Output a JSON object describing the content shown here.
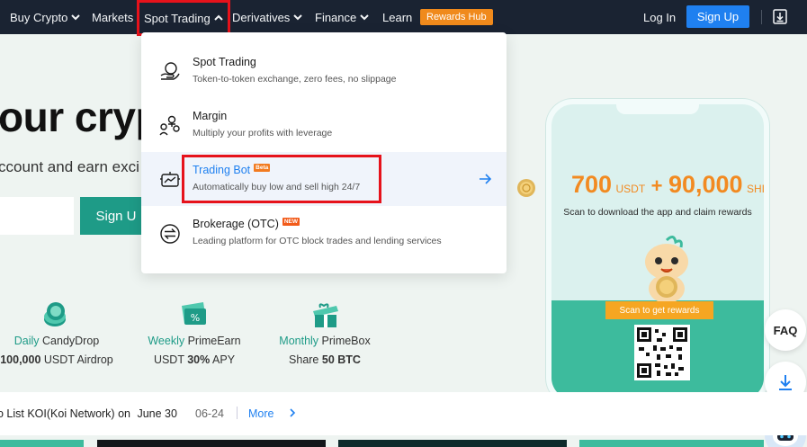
{
  "nav": {
    "items": [
      {
        "label": "Buy Crypto",
        "has_chevron": true
      },
      {
        "label": "Markets",
        "has_chevron": false
      },
      {
        "label": "Spot Trading",
        "has_chevron": true,
        "active": true
      },
      {
        "label": "Derivatives",
        "has_chevron": true
      },
      {
        "label": "Finance",
        "has_chevron": true
      },
      {
        "label": "Learn",
        "has_chevron": false
      }
    ],
    "rewards_hub": "Rewards Hub",
    "login": "Log In",
    "signup": "Sign Up",
    "download_icon": "download-icon"
  },
  "hero": {
    "title": "our cryp",
    "subtitle": "ccount and earn exci",
    "email_placeholder": "",
    "signup_label": "Sign U"
  },
  "features": [
    {
      "highlight": "Daily",
      "title": " CandyDrop",
      "desc_bold": "100,000",
      "desc": " USDT Airdrop"
    },
    {
      "highlight": "Weekly",
      "title": " PrimeEarn",
      "desc": "USDT ",
      "desc_bold": "30%",
      "desc_tail": " APY"
    },
    {
      "highlight": "Monthly",
      "title": " PrimeBox",
      "desc": "Share ",
      "desc_bold": "50 BTC"
    }
  ],
  "dropdown": {
    "items": [
      {
        "title": "Spot Trading",
        "desc": "Token-to-token exchange, zero fees, no slippage",
        "icon": "hand-coin-icon"
      },
      {
        "title": "Margin",
        "desc": "Multiply your profits with leverage",
        "icon": "people-coins-icon"
      },
      {
        "title": "Trading Bot",
        "badge": "Beta",
        "desc": "Automatically buy low and sell high 24/7",
        "icon": "bot-chart-icon",
        "hovered": true
      },
      {
        "title": "Brokerage (OTC)",
        "badge": "NEW",
        "desc": "Leading platform for OTC block trades and lending services",
        "icon": "swap-arrows-icon"
      }
    ]
  },
  "promo": {
    "amount1": "700",
    "unit1": "USDT",
    "plus": "+",
    "amount2": "90,000",
    "unit2": "SHIB",
    "scan_text": "Scan to download the app and claim rewards",
    "ribbon": "Scan to get rewards"
  },
  "side": {
    "faq": "FAQ"
  },
  "ticker": {
    "text": "o List KOI(Koi Network) on",
    "date_bold": "June 30",
    "date": "06-24",
    "more": "More"
  },
  "colors": {
    "nav_bg": "#1a2332",
    "accent_green": "#1e9b87",
    "accent_blue": "#1f80f0",
    "promo_orange": "#f28a21",
    "highlight_red": "#e6121b"
  }
}
